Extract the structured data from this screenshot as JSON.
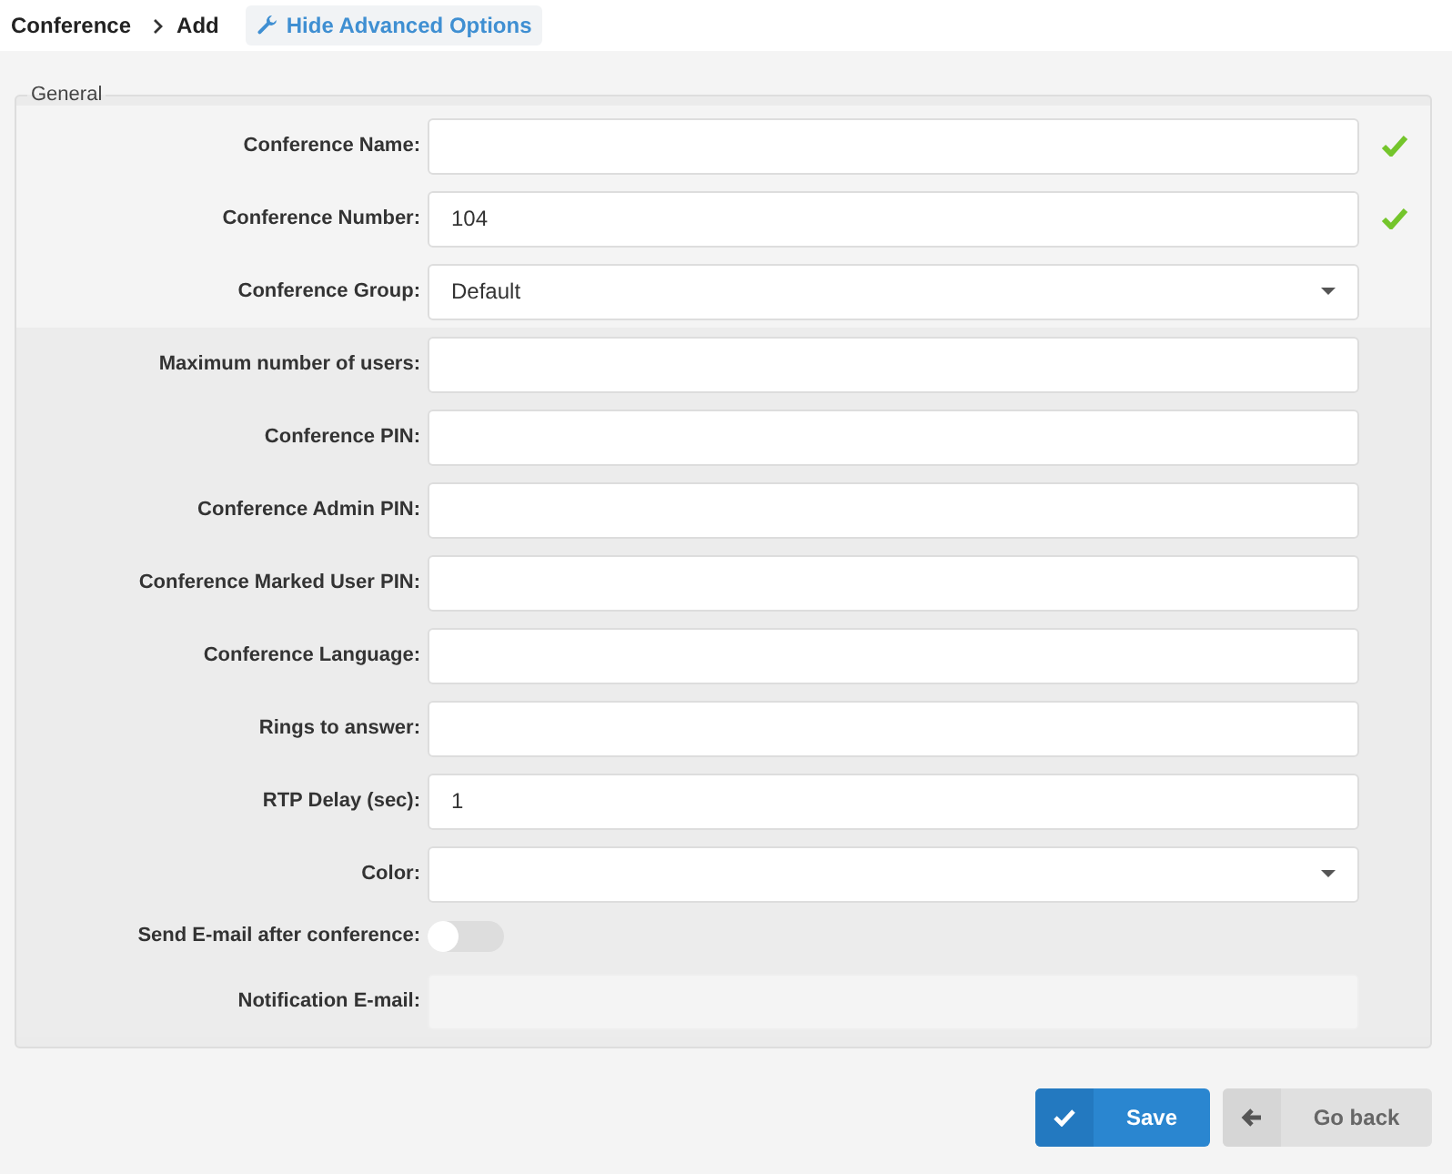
{
  "breadcrumb": [
    "Conference",
    "Add"
  ],
  "advanced_toggle": {
    "label": "Hide Advanced Options"
  },
  "fieldset": {
    "legend": "General",
    "sections": [
      {
        "kind": "basic",
        "fields": [
          {
            "kind": "text",
            "label": "Conference Name:",
            "valid": true
          },
          {
            "kind": "text",
            "label": "Conference Number:",
            "value": "104",
            "valid": true
          },
          {
            "kind": "select",
            "label": "Conference Group:",
            "value": "Default"
          }
        ]
      },
      {
        "kind": "advanced",
        "fields": [
          {
            "kind": "text",
            "label": "Maximum number of users:"
          },
          {
            "kind": "text",
            "label": "Conference PIN:"
          },
          {
            "kind": "text",
            "label": "Conference Admin PIN:"
          },
          {
            "kind": "text",
            "label": "Conference Marked User PIN:"
          },
          {
            "kind": "text",
            "label": "Conference Language:"
          },
          {
            "kind": "text",
            "label": "Rings to answer:"
          },
          {
            "kind": "text",
            "label": "RTP Delay (sec):",
            "value": "1"
          },
          {
            "kind": "select",
            "label": "Color:"
          },
          {
            "kind": "toggle",
            "label": "Send E-mail after conference:",
            "on": false
          },
          {
            "kind": "text",
            "label": "Notification E-mail:",
            "disabled": true
          }
        ]
      }
    ]
  },
  "buttons": [
    {
      "kind": "save",
      "label": "Save"
    },
    {
      "kind": "back",
      "label": "Go back"
    }
  ]
}
